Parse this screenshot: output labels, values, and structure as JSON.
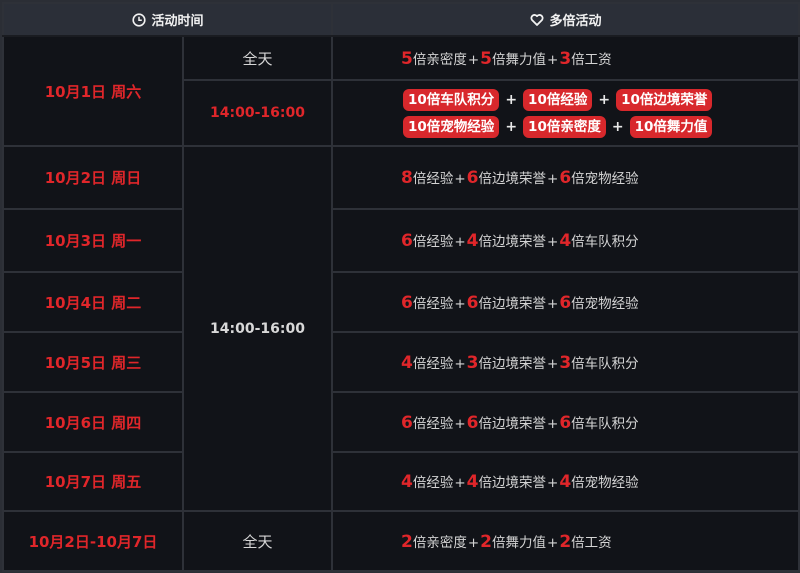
{
  "header": {
    "time_col": {
      "icon": "clock-icon",
      "label": "活动时间"
    },
    "activity_col": {
      "icon": "heart-icon",
      "label": "多倍活动"
    }
  },
  "colors": {
    "accent": "#e0262a",
    "badge": "#d8282c",
    "header_bg": "#2b2f38",
    "cell_bg": "#111318"
  },
  "oct1": {
    "date": "10月1日 周六",
    "allday": {
      "time": "全天",
      "items": [
        {
          "mult": "5",
          "name": "倍亲密度"
        },
        {
          "mult": "5",
          "name": "倍舞力值"
        },
        {
          "mult": "3",
          "name": "倍工资"
        }
      ]
    },
    "timed": {
      "time": "14:00-16:00",
      "badges_line1": [
        "10倍车队积分",
        "10倍经验",
        "10倍边境荣誉"
      ],
      "badges_line2": [
        "10倍宠物经验",
        "10倍亲密度",
        "10倍舞力值"
      ]
    }
  },
  "shared_time": "14:00-16:00",
  "days": [
    {
      "date": "10月2日 周日",
      "items": [
        {
          "mult": "8",
          "name": "倍经验"
        },
        {
          "mult": "6",
          "name": "倍边境荣誉"
        },
        {
          "mult": "6",
          "name": "倍宠物经验"
        }
      ]
    },
    {
      "date": "10月3日 周一",
      "items": [
        {
          "mult": "6",
          "name": "倍经验"
        },
        {
          "mult": "4",
          "name": "倍边境荣誉"
        },
        {
          "mult": "4",
          "name": "倍车队积分"
        }
      ]
    },
    {
      "date": "10月4日 周二",
      "items": [
        {
          "mult": "6",
          "name": "倍经验"
        },
        {
          "mult": "6",
          "name": "倍边境荣誉"
        },
        {
          "mult": "6",
          "name": "倍宠物经验"
        }
      ]
    },
    {
      "date": "10月5日 周三",
      "items": [
        {
          "mult": "4",
          "name": "倍经验"
        },
        {
          "mult": "3",
          "name": "倍边境荣誉"
        },
        {
          "mult": "3",
          "name": "倍车队积分"
        }
      ]
    },
    {
      "date": "10月6日 周四",
      "items": [
        {
          "mult": "6",
          "name": "倍经验"
        },
        {
          "mult": "6",
          "name": "倍边境荣誉"
        },
        {
          "mult": "6",
          "name": "倍车队积分"
        }
      ]
    },
    {
      "date": "10月7日 周五",
      "items": [
        {
          "mult": "4",
          "name": "倍经验"
        },
        {
          "mult": "4",
          "name": "倍边境荣誉"
        },
        {
          "mult": "4",
          "name": "倍宠物经验"
        }
      ]
    }
  ],
  "range": {
    "date": "10月2日-10月7日",
    "time": "全天",
    "items": [
      {
        "mult": "2",
        "name": "倍亲密度"
      },
      {
        "mult": "2",
        "name": "倍舞力值"
      },
      {
        "mult": "2",
        "name": "倍工资"
      }
    ]
  },
  "plus": "+"
}
